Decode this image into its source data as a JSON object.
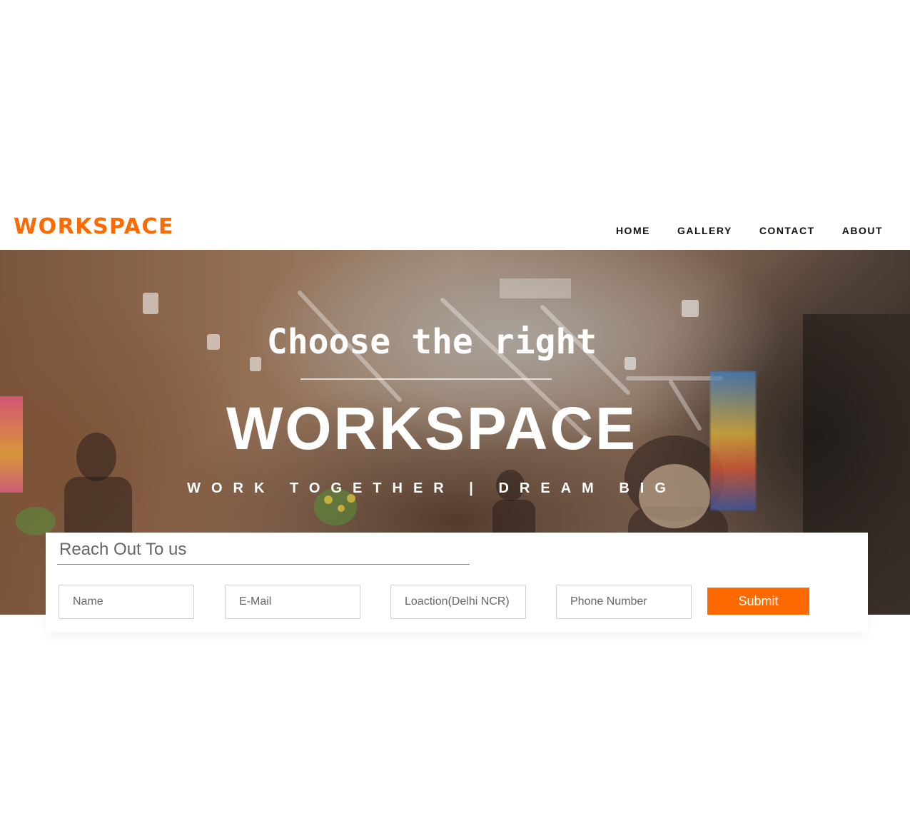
{
  "header": {
    "brand": "WORKSPACE",
    "nav": [
      {
        "label": "HOME"
      },
      {
        "label": "GALLERY"
      },
      {
        "label": "CONTACT"
      },
      {
        "label": "ABOUT"
      }
    ]
  },
  "hero": {
    "kicker": "Choose the right",
    "title": "WORKSPACE",
    "tagline": "WORK TOGETHER | DREAM BIG"
  },
  "contact": {
    "heading": "Reach Out To us",
    "fields": {
      "name_placeholder": "Name",
      "email_placeholder": "E-Mail",
      "location_placeholder": "Loaction(Delhi NCR)",
      "phone_placeholder": "Phone Number"
    },
    "submit_label": "Submit"
  },
  "colors": {
    "accent": "#ff6a00",
    "nav_text": "#111111",
    "hero_text": "#ffffff"
  }
}
